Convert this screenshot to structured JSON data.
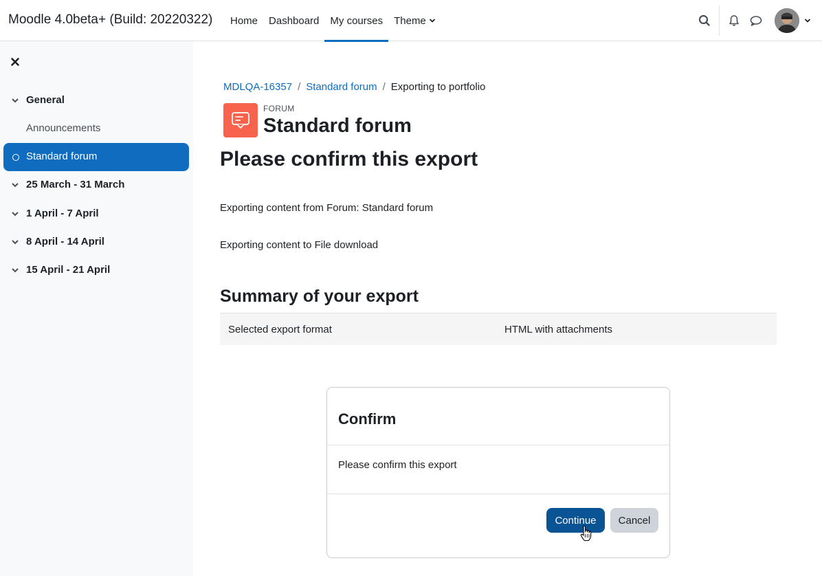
{
  "navbar": {
    "brand": "Moodle 4.0beta+ (Build: 20220322)",
    "links": [
      {
        "label": "Home"
      },
      {
        "label": "Dashboard"
      },
      {
        "label": "My courses"
      },
      {
        "label": "Theme"
      }
    ],
    "active_link": "My courses",
    "icons": [
      "search-icon",
      "bell-icon",
      "chat-icon"
    ]
  },
  "drawer": {
    "items": [
      {
        "label": "General",
        "type": "section"
      },
      {
        "label": "Announcements",
        "type": "activity"
      },
      {
        "label": "Standard forum",
        "type": "activity",
        "active": true
      },
      {
        "label": "25 March - 31 March",
        "type": "section"
      },
      {
        "label": "1 April - 7 April",
        "type": "section"
      },
      {
        "label": "8 April - 14 April",
        "type": "section"
      },
      {
        "label": "15 April - 21 April",
        "type": "section"
      }
    ]
  },
  "breadcrumb": {
    "items": [
      "MDLQA-16357",
      "Standard forum"
    ],
    "current": "Exporting to portfolio"
  },
  "activity": {
    "kicker": "FORUM",
    "title": "Standard forum"
  },
  "main": {
    "heading": "Please confirm this export",
    "line1": "Exporting content from Forum: Standard forum",
    "line2": "Exporting content to File download",
    "summary_heading": "Summary of your export",
    "summary_rows": [
      {
        "label": "Selected export format",
        "value": "HTML with attachments"
      }
    ]
  },
  "confirm": {
    "title": "Confirm",
    "body": "Please confirm this export",
    "continue_label": "Continue",
    "cancel_label": "Cancel"
  },
  "colors": {
    "primary": "#0f6cbf",
    "forum_icon": "#f7634d"
  }
}
